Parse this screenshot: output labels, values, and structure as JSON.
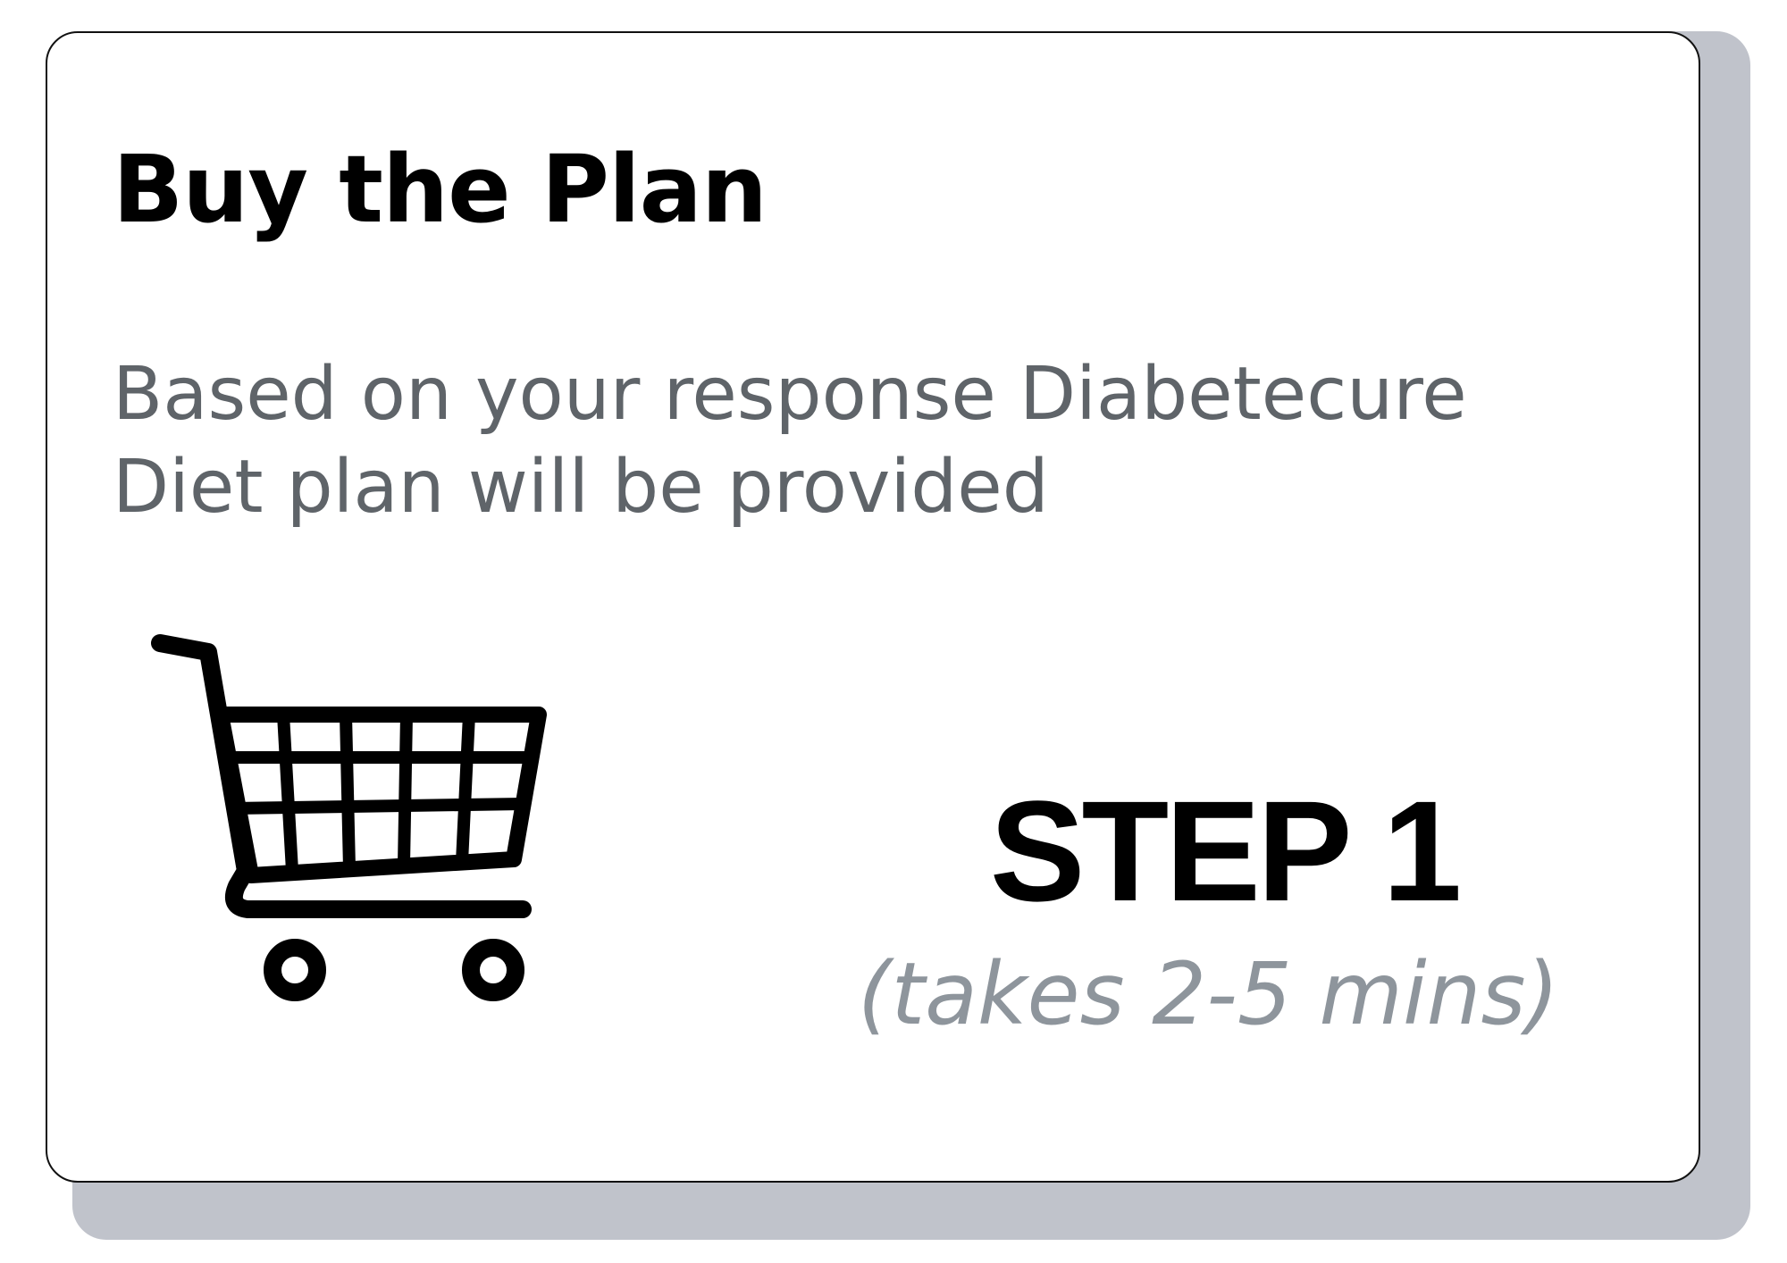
{
  "card": {
    "title": "Buy the Plan",
    "description": "Based on your response Diabetecure Diet plan will be provided",
    "step_label": "STEP 1",
    "duration": "(takes 2-5 mins)",
    "icon": "shopping-cart-icon"
  },
  "colors": {
    "title": "#000000",
    "description": "#5f6469",
    "duration": "#8e959c",
    "shadow": "#c0c3cb",
    "card_border": "#111111"
  }
}
